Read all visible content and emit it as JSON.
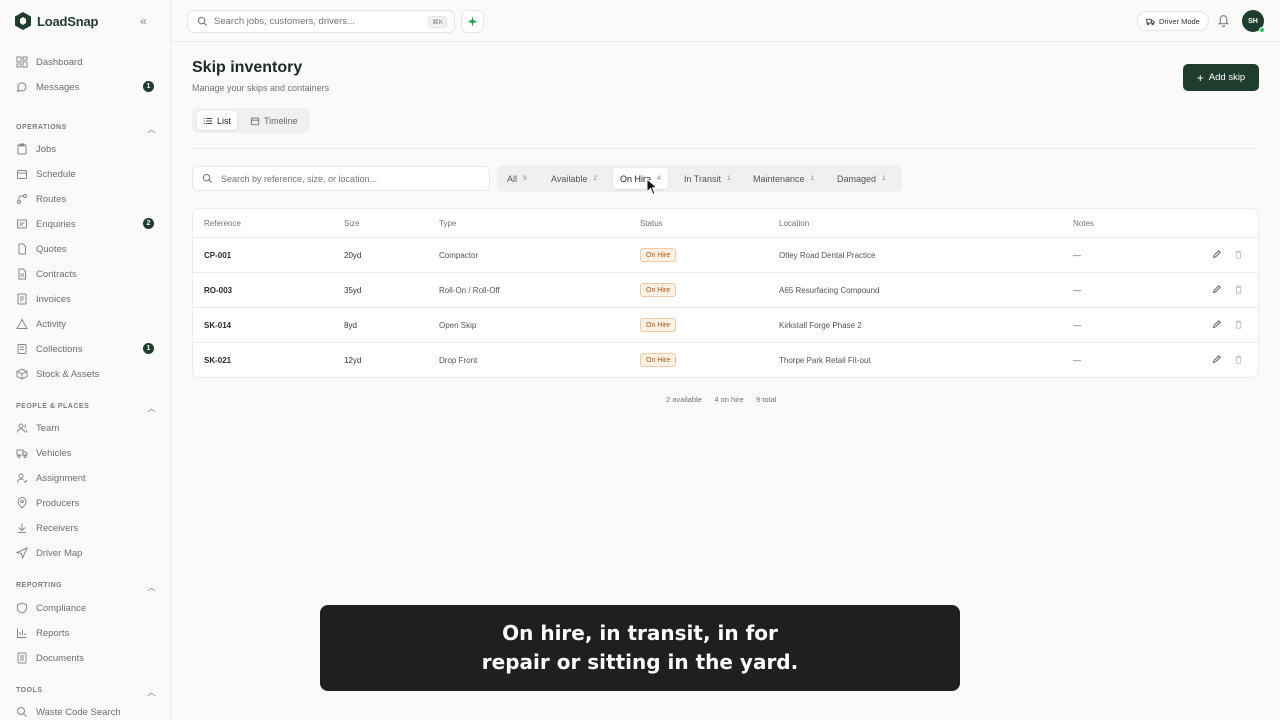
{
  "brand": {
    "name": "LoadSnap"
  },
  "sidebar": {
    "top_items": [
      {
        "label": "Dashboard",
        "icon": "dashboard-icon"
      },
      {
        "label": "Messages",
        "icon": "message-icon",
        "badge": "1"
      }
    ],
    "sections": [
      {
        "title": "OPERATIONS",
        "items": [
          {
            "label": "Jobs",
            "icon": "clipboard-icon"
          },
          {
            "label": "Schedule",
            "icon": "calendar-icon"
          },
          {
            "label": "Routes",
            "icon": "route-icon"
          },
          {
            "label": "Enquiries",
            "icon": "inbox-icon",
            "badge": "2"
          },
          {
            "label": "Quotes",
            "icon": "document-icon"
          },
          {
            "label": "Contracts",
            "icon": "contract-icon"
          },
          {
            "label": "Invoices",
            "icon": "invoice-icon"
          },
          {
            "label": "Activity",
            "icon": "activity-icon"
          },
          {
            "label": "Collections",
            "icon": "collections-icon",
            "badge": "1"
          },
          {
            "label": "Stock & Assets",
            "icon": "box-icon"
          }
        ]
      },
      {
        "title": "PEOPLE & PLACES",
        "items": [
          {
            "label": "Team",
            "icon": "team-icon"
          },
          {
            "label": "Vehicles",
            "icon": "truck-icon"
          },
          {
            "label": "Assignment",
            "icon": "assignment-icon"
          },
          {
            "label": "Producers",
            "icon": "pin-icon"
          },
          {
            "label": "Receivers",
            "icon": "receive-icon"
          },
          {
            "label": "Driver Map",
            "icon": "navigation-icon"
          }
        ]
      },
      {
        "title": "REPORTING",
        "items": [
          {
            "label": "Compliance",
            "icon": "shield-icon"
          },
          {
            "label": "Reports",
            "icon": "bar-chart-icon"
          },
          {
            "label": "Documents",
            "icon": "documents-icon"
          }
        ]
      },
      {
        "title": "TOOLS",
        "items": [
          {
            "label": "Waste Code Search",
            "icon": "search-icon"
          }
        ]
      }
    ]
  },
  "topbar": {
    "search_placeholder": "Search jobs, customers, drivers...",
    "search_shortcut": "⌘K",
    "driver_mode_label": "Driver Mode",
    "avatar_initials": "SH"
  },
  "page": {
    "title": "Skip inventory",
    "subtitle": "Manage your skips and containers",
    "add_button_label": "Add skip",
    "views": [
      "List",
      "Timeline"
    ],
    "active_view": "List"
  },
  "table_search_placeholder": "Search by reference, size, or location...",
  "filters": [
    {
      "label": "All",
      "count": "9"
    },
    {
      "label": "Available",
      "count": "2"
    },
    {
      "label": "On Hire",
      "count": "4",
      "active": true
    },
    {
      "label": "In Transit",
      "count": "1"
    },
    {
      "label": "Maintenance",
      "count": "1"
    },
    {
      "label": "Damaged",
      "count": "1"
    }
  ],
  "table": {
    "columns": [
      "Reference",
      "Size",
      "Type",
      "Status",
      "Location",
      "Notes"
    ],
    "rows": [
      {
        "reference": "CP-001",
        "size": "20yd",
        "type": "Compactor",
        "status": "On Hire",
        "location": "Otley Road Dental Practice",
        "notes": "—"
      },
      {
        "reference": "RO-003",
        "size": "35yd",
        "type": "Roll-On / Roll-Off",
        "status": "On Hire",
        "location": "A65 Resurfacing Compound",
        "notes": "—"
      },
      {
        "reference": "SK-014",
        "size": "8yd",
        "type": "Open Skip",
        "status": "On Hire",
        "location": "Kirkstall Forge Phase 2",
        "notes": "—"
      },
      {
        "reference": "SK-021",
        "size": "12yd",
        "type": "Drop Front",
        "status": "On Hire",
        "location": "Thorpe Park Retail Fit-out",
        "notes": "—"
      }
    ]
  },
  "summary": {
    "available": "2 available",
    "on_hire": "4 on hire",
    "total": "9 total"
  },
  "caption": {
    "line1": "On hire, in transit, in for",
    "line2": "repair or sitting in the yard."
  },
  "colors": {
    "brand": "#1e3d2f",
    "status_on_hire": "#b45309"
  }
}
